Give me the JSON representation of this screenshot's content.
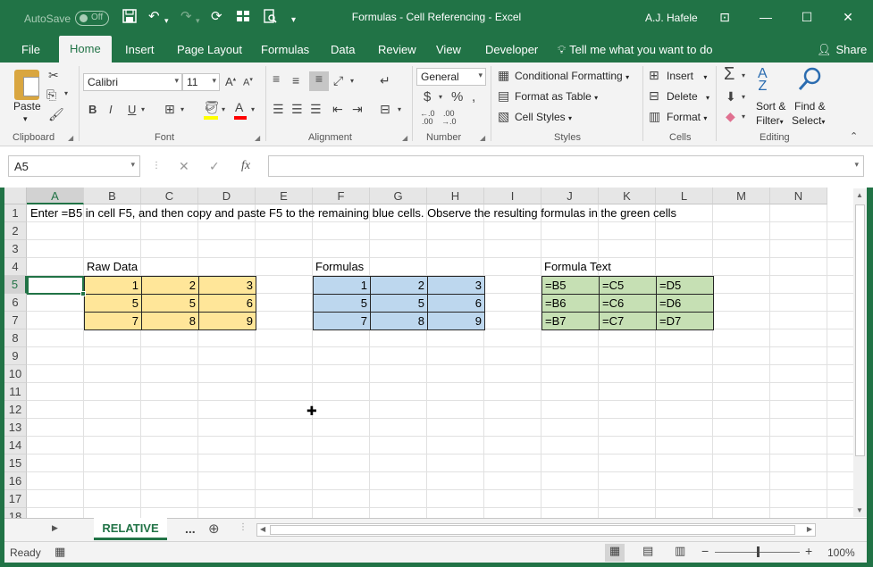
{
  "titlebar": {
    "autosave_label": "AutoSave",
    "autosave_state": "Off",
    "title": "Formulas - Cell Referencing - Excel",
    "user": "A.J. Hafele"
  },
  "tabs": [
    "File",
    "Home",
    "Insert",
    "Page Layout",
    "Formulas",
    "Data",
    "Review",
    "View",
    "Developer"
  ],
  "tell_me": "Tell me what you want to do",
  "share": "Share",
  "ribbon": {
    "clipboard": {
      "label": "Clipboard",
      "paste": "Paste"
    },
    "font": {
      "label": "Font",
      "name": "Calibri",
      "size": "11"
    },
    "alignment": {
      "label": "Alignment"
    },
    "number": {
      "label": "Number",
      "format": "General"
    },
    "styles": {
      "label": "Styles",
      "conditional": "Conditional Formatting",
      "table": "Format as Table",
      "cell_styles": "Cell Styles"
    },
    "cells": {
      "label": "Cells",
      "insert": "Insert",
      "delete": "Delete",
      "format": "Format"
    },
    "editing": {
      "label": "Editing",
      "sort": "Sort &",
      "filter": "Filter",
      "find": "Find &",
      "select": "Select"
    }
  },
  "formula_bar": {
    "name_box": "A5",
    "formula": ""
  },
  "columns": [
    "A",
    "B",
    "C",
    "D",
    "E",
    "F",
    "G",
    "H",
    "I",
    "J",
    "K",
    "L",
    "M",
    "N"
  ],
  "rows": [
    "1",
    "2",
    "3",
    "4",
    "5",
    "6",
    "7",
    "8",
    "9",
    "10",
    "11",
    "12",
    "13",
    "14",
    "15",
    "16",
    "17",
    "18"
  ],
  "sheet": {
    "instruction": "Enter =B5 in cell F5, and then copy and paste F5 to the remaining blue cells.  Observe the resulting formulas in the green cells",
    "raw_data_label": "Raw Data",
    "formulas_label": "Formulas",
    "formula_text_label": "Formula Text",
    "raw_data": [
      [
        "1",
        "2",
        "3"
      ],
      [
        "5",
        "5",
        "6"
      ],
      [
        "7",
        "8",
        "9"
      ]
    ],
    "formulas": [
      [
        "1",
        "2",
        "3"
      ],
      [
        "5",
        "5",
        "6"
      ],
      [
        "7",
        "8",
        "9"
      ]
    ],
    "formula_text": [
      [
        "=B5",
        "=C5",
        "=D5"
      ],
      [
        "=B6",
        "=C6",
        "=D6"
      ],
      [
        "=B7",
        "=C7",
        "=D7"
      ]
    ]
  },
  "sheet_tabs": {
    "active": "RELATIVE",
    "more": "..."
  },
  "status": {
    "ready": "Ready",
    "zoom": "100%"
  },
  "colors": {
    "excel_green": "#217346",
    "raw_fill": "#ffe699",
    "formula_fill": "#bdd7ee",
    "text_fill": "#c6e0b4"
  }
}
